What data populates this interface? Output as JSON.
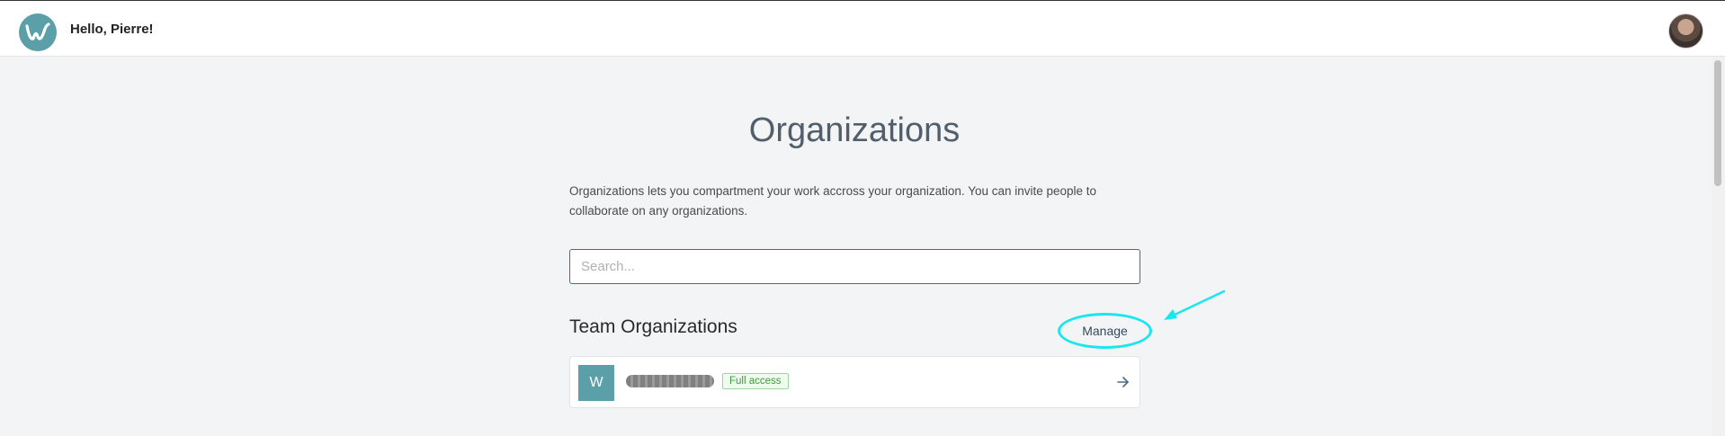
{
  "header": {
    "greeting": "Hello, Pierre!",
    "logo_letter": "w"
  },
  "page": {
    "title": "Organizations",
    "description": "Organizations lets you compartment your work accross your organization. You can invite people to collaborate on any organizations."
  },
  "search": {
    "placeholder": "Search..."
  },
  "team_section": {
    "title": "Team Organizations",
    "manage_label": "Manage"
  },
  "organizations": [
    {
      "initial": "W",
      "badge": "Full access"
    }
  ],
  "colors": {
    "accent": "#5b9fa8",
    "annotation": "#19e6ee",
    "badge_text": "#3a9c3a"
  }
}
